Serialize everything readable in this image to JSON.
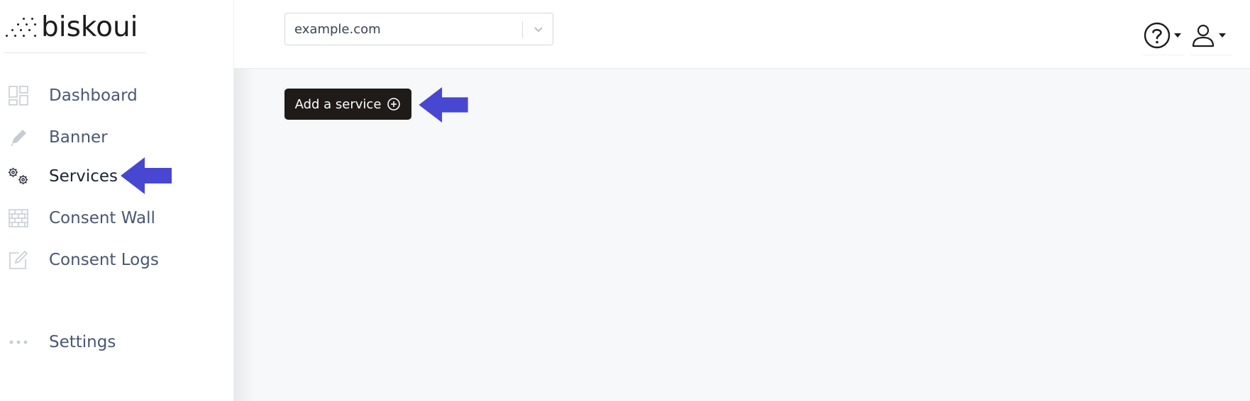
{
  "brand": {
    "name": "biskoui"
  },
  "sidebar": {
    "items": [
      {
        "label": "Dashboard",
        "icon": "dashboard-icon"
      },
      {
        "label": "Banner",
        "icon": "pencil-icon"
      },
      {
        "label": "Services",
        "icon": "gears-icon",
        "active": true
      },
      {
        "label": "Consent Wall",
        "icon": "brick-wall-icon"
      },
      {
        "label": "Consent Logs",
        "icon": "edit-note-icon"
      },
      {
        "label": "Settings",
        "icon": "more-dots-icon"
      }
    ]
  },
  "topbar": {
    "site_select": {
      "value": "example.com"
    },
    "help_icon": "help-circle-icon",
    "user_icon": "user-icon"
  },
  "main": {
    "add_service_label": "Add a service"
  },
  "colors": {
    "annotation_arrow": "#4747d1",
    "button_bg": "#1e1b18",
    "main_bg": "#f7f8fa",
    "nav_text": "#4a5673"
  }
}
